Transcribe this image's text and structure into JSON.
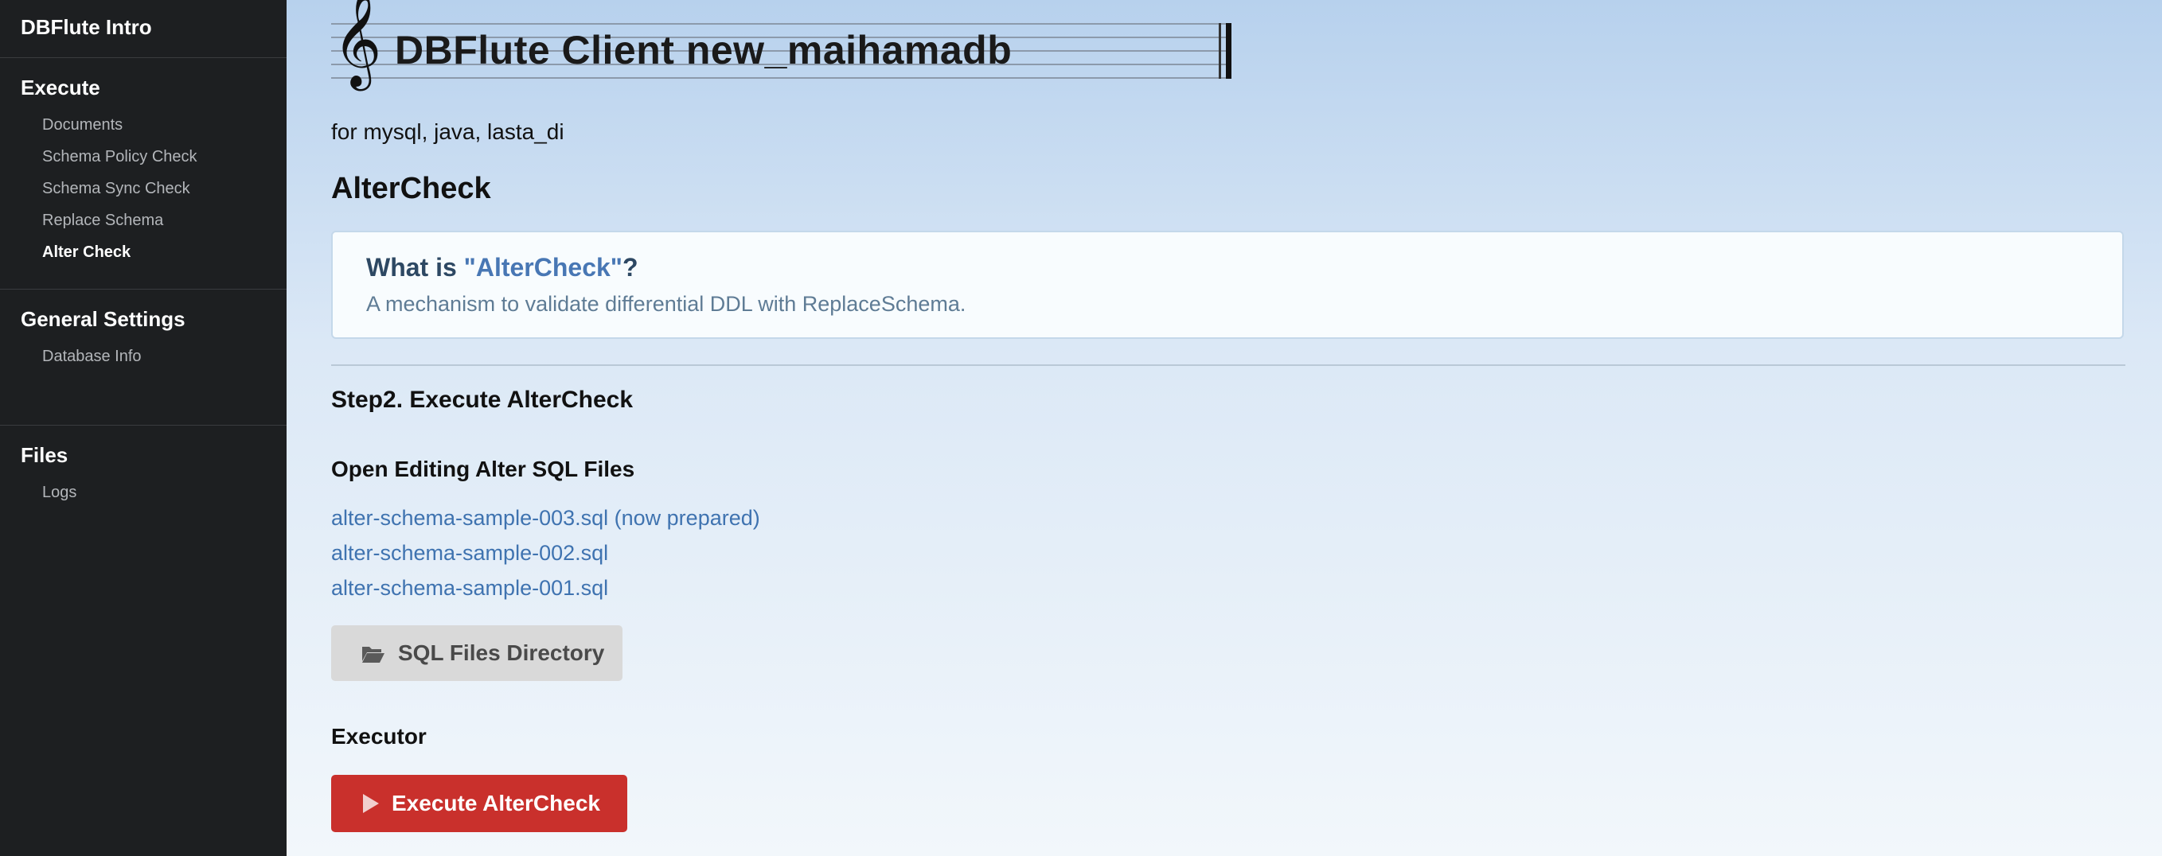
{
  "sidebar": {
    "brand": "DBFlute Intro",
    "sections": [
      {
        "title": "Execute",
        "items": [
          {
            "label": "Documents",
            "active": false
          },
          {
            "label": "Schema Policy Check",
            "active": false
          },
          {
            "label": "Schema Sync Check",
            "active": false
          },
          {
            "label": "Replace Schema",
            "active": false
          },
          {
            "label": "Alter Check",
            "active": true
          }
        ]
      },
      {
        "title": "General Settings",
        "items": [
          {
            "label": "Database Info",
            "active": false
          }
        ]
      },
      {
        "title": "Files",
        "items": [
          {
            "label": "Logs",
            "active": false
          }
        ]
      }
    ]
  },
  "main": {
    "title": "DBFlute Client new_maihamadb",
    "subtitle": "for mysql, java, lasta_di",
    "heading": "AlterCheck",
    "info": {
      "title_prefix": "What is ",
      "title_highlight": "\"AlterCheck\"",
      "title_suffix": "?",
      "description": "A mechanism to validate differential DDL with ReplaceSchema."
    },
    "step_heading": "Step2. Execute AlterCheck",
    "open_files_heading": "Open Editing Alter SQL Files",
    "files": [
      "alter-schema-sample-003.sql (now prepared)",
      "alter-schema-sample-002.sql",
      "alter-schema-sample-001.sql"
    ],
    "sql_dir_button": "SQL Files Directory",
    "executor_heading": "Executor",
    "execute_button": "Execute AlterCheck"
  },
  "colors": {
    "sidebar_bg": "#1d1f21",
    "link": "#3f73b0",
    "execute_button": "#c9302c",
    "info_highlight": "#4877b4"
  },
  "icons": {
    "clef": "treble-clef-icon",
    "folder": "folder-open-icon",
    "play": "play-icon"
  }
}
